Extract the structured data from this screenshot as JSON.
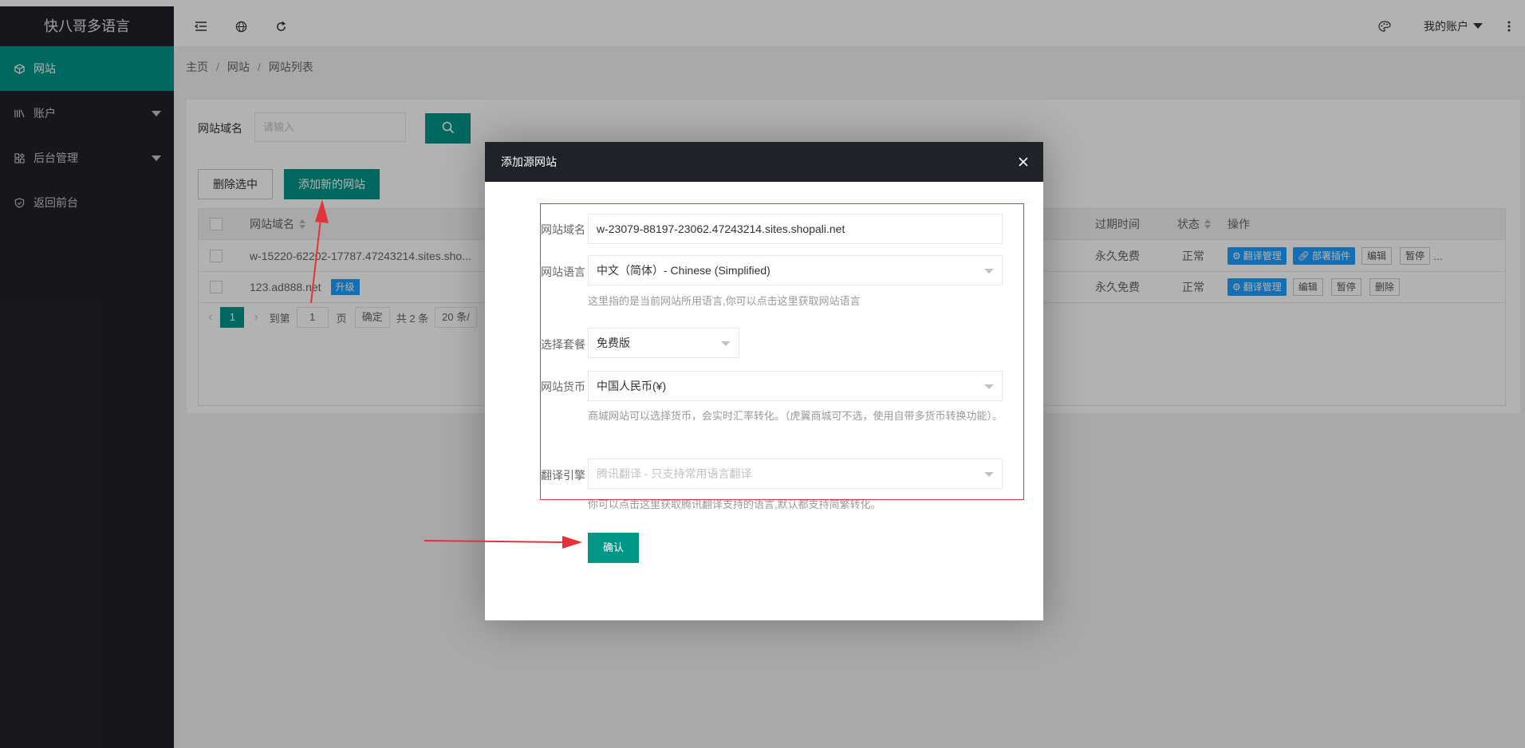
{
  "app": {
    "title": "快八哥多语言"
  },
  "sidebar": {
    "items": [
      {
        "label": "网站",
        "icon": "cube-icon",
        "active": true
      },
      {
        "label": "账户",
        "icon": "bars-icon",
        "caret": true
      },
      {
        "label": "后台管理",
        "icon": "apps-icon",
        "caret": true
      },
      {
        "label": "返回前台",
        "icon": "shield-icon"
      }
    ]
  },
  "header": {
    "account_label": "我的账户"
  },
  "breadcrumb": {
    "items": [
      "主页",
      "网站",
      "网站列表"
    ],
    "sep": "/"
  },
  "search": {
    "label": "网站域名",
    "placeholder": "请输入"
  },
  "toolbar": {
    "delete_label": "删除选中",
    "add_label": "添加新的网站"
  },
  "table": {
    "headers": {
      "domain": "网站域名",
      "expire": "过期时间",
      "status": "状态",
      "actions": "操作"
    },
    "rows": [
      {
        "domain": "w-15220-62202-17787.47243214.sites.sho...",
        "expire": "永久免费",
        "status": "正常",
        "actions": {
          "translate": "翻译管理",
          "deploy": "部署插件",
          "edit": "编辑",
          "pause": "暂停",
          "more": "..."
        }
      },
      {
        "domain": "123.ad888.net",
        "tag": "升级",
        "expire": "永久免费",
        "status": "正常",
        "actions": {
          "translate": "翻译管理",
          "edit": "编辑",
          "pause": "暂停",
          "delete": "删除"
        }
      }
    ]
  },
  "pager": {
    "current": "1",
    "goto_label": "到第",
    "page_value": "1",
    "page_unit": "页",
    "confirm": "确定",
    "total": "共 2 条",
    "per_page": "20 条/"
  },
  "modal": {
    "title": "添加源网站",
    "fields": {
      "domain": {
        "label": "网站域名",
        "value": "w-23079-88197-23062.47243214.sites.shopali.net"
      },
      "language": {
        "label": "网站语言",
        "value": "中文（简体）- Chinese (Simplified)",
        "help": "这里指的是当前网站所用语言,你可以点击这里获取网站语言"
      },
      "plan": {
        "label": "选择套餐",
        "value": "免费版"
      },
      "currency": {
        "label": "网站货币",
        "value": "中国人民币(¥)",
        "help": "商城网站可以选择货币，会实时汇率转化。（虎翼商城可不选，使用自带多货币转换功能）。"
      },
      "engine": {
        "label": "翻译引擎",
        "value": "腾讯翻译 - 只支持常用语言翻译",
        "help": "你可以点击这里获取腾讯翻译支持的语言,默认都支持简繁转化。"
      }
    },
    "confirm_label": "确认"
  },
  "colors": {
    "primary": "#009688",
    "sidebar": "#20222a",
    "accent_blue": "#1e9fff",
    "annotation": "#e2333a"
  }
}
